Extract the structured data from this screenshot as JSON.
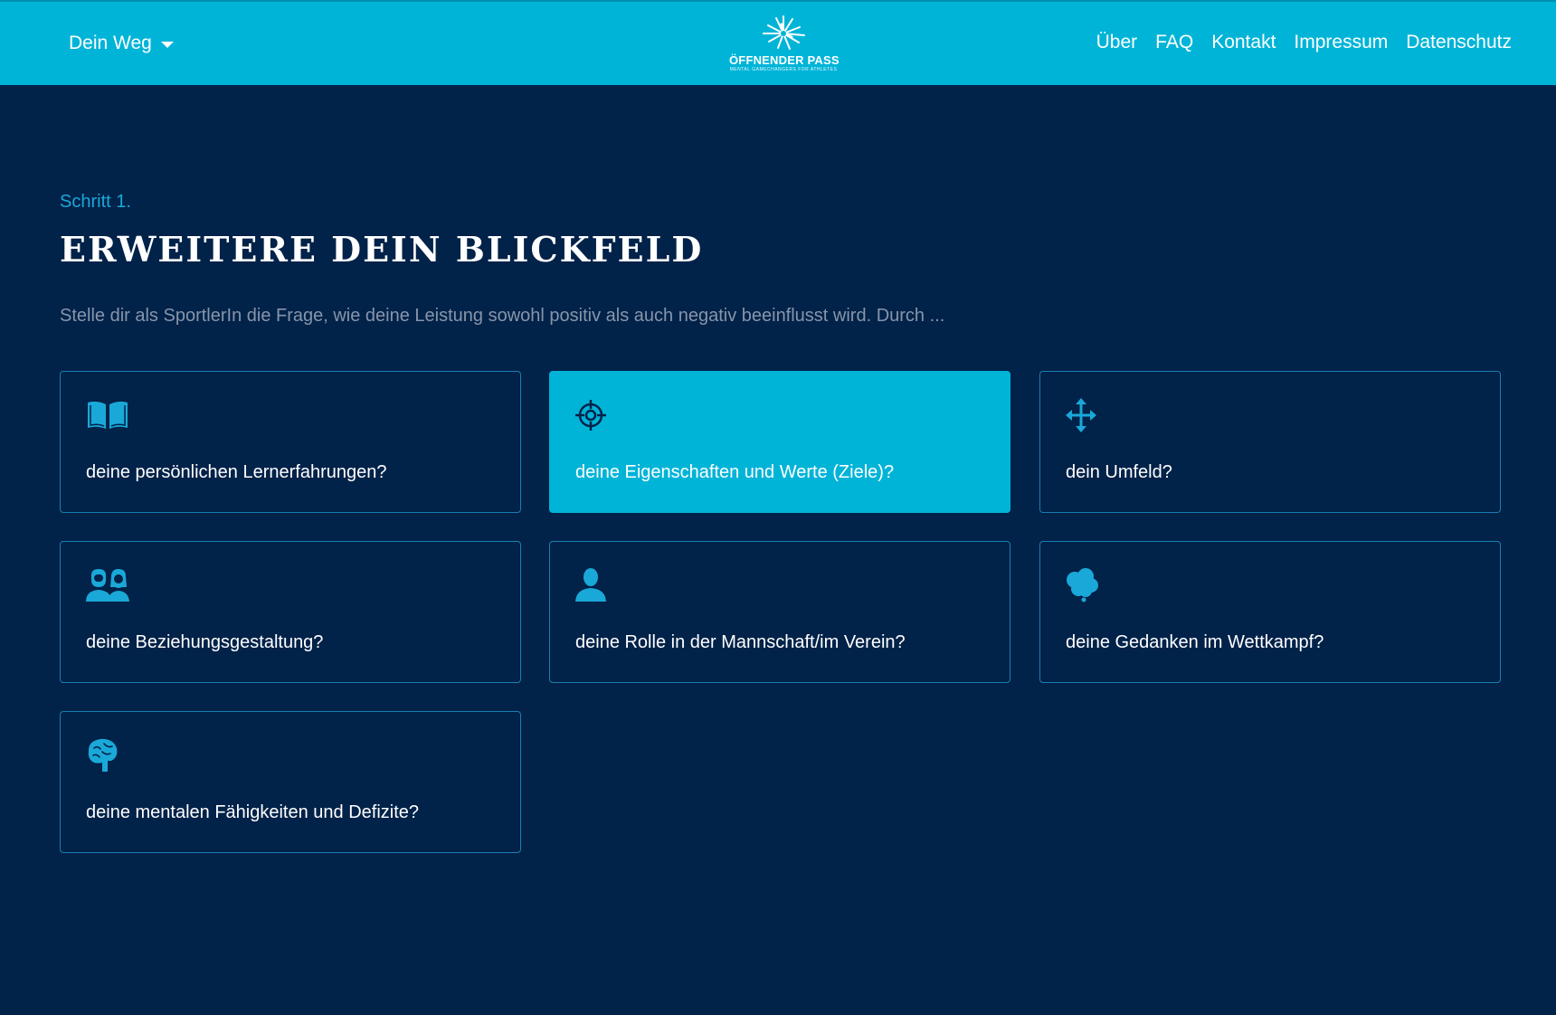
{
  "nav": {
    "dropdown_label": "Dein Weg",
    "logo_text": "ÖFFNENDER PASS",
    "logo_subtext": "MENTAL GAMECHANGERS FOR ATHLETES",
    "links": [
      "Über",
      "FAQ",
      "Kontakt",
      "Impressum",
      "Datenschutz"
    ]
  },
  "main": {
    "step_label": "Schritt 1.",
    "title": "ERWEITERE DEIN BLICKFELD",
    "intro": "Stelle dir als SportlerIn die Frage, wie deine Leistung sowohl positiv als auch negativ beeinflusst wird. Durch ...",
    "cards": [
      {
        "icon": "book-icon",
        "label": "deine persönlichen Lernerfahrungen?",
        "active": false
      },
      {
        "icon": "crosshair-icon",
        "label": "deine Eigenschaften und Werte (Ziele)?",
        "active": true
      },
      {
        "icon": "move-arrows-icon",
        "label": "dein Umfeld?",
        "active": false
      },
      {
        "icon": "couple-icon",
        "label": "deine Beziehungsgestaltung?",
        "active": false
      },
      {
        "icon": "user-icon",
        "label": "deine Rolle in der Mannschaft/im Verein?",
        "active": false
      },
      {
        "icon": "thought-cloud-icon",
        "label": "deine Gedanken im Wettkampf?",
        "active": false
      },
      {
        "icon": "brain-icon",
        "label": "deine mentalen Fähigkeiten und Defizite?",
        "active": false
      }
    ]
  },
  "colors": {
    "navbar": "#00b4d8",
    "background": "#012249",
    "accent": "#1aa8d8",
    "card_border": "#1a7fb0",
    "intro_text": "#8795ab"
  }
}
